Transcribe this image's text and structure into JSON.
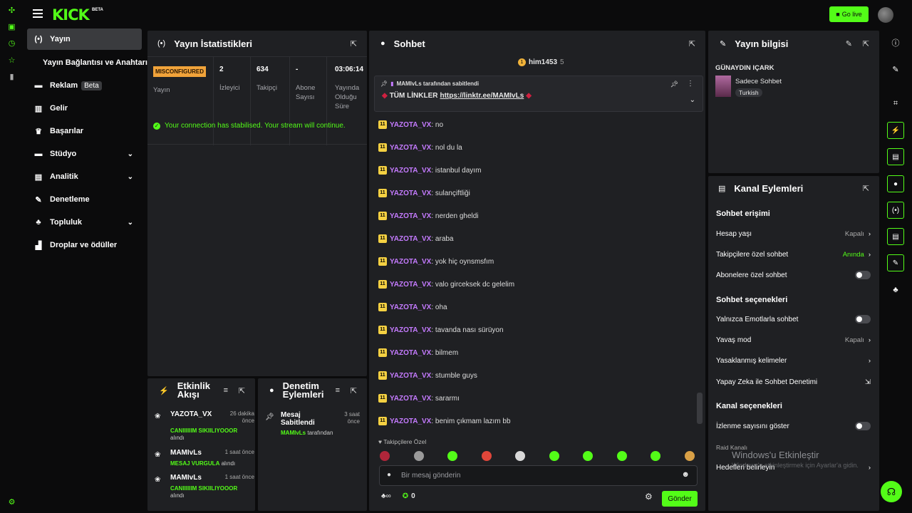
{
  "top": {
    "brand": "KICK",
    "brand_sup": "BETA",
    "golive": "Go live"
  },
  "left_rail_icons": [
    "compass-icon",
    "video-icon",
    "clock-icon",
    "star-icon",
    "shield-icon",
    "gear-icon"
  ],
  "sidebar": {
    "items": [
      {
        "label": "Yayın",
        "icon": "broadcast-icon",
        "active": true
      },
      {
        "label": "Yayın Bağlantısı ve Anahtarı"
      },
      {
        "label": "Reklam",
        "badge": "Beta",
        "icon": "ad-icon"
      },
      {
        "label": "Gelir",
        "icon": "chart-icon"
      },
      {
        "label": "Başarılar",
        "icon": "trophy-icon"
      },
      {
        "label": "Stüdyo",
        "icon": "studio-icon",
        "expand": true
      },
      {
        "label": "Analitik",
        "icon": "analytics-icon",
        "expand": true
      },
      {
        "label": "Denetleme",
        "icon": "wrench-icon"
      },
      {
        "label": "Topluluk",
        "icon": "community-icon",
        "expand": true
      },
      {
        "label": "Droplar ve ödüller",
        "icon": "drops-icon"
      }
    ]
  },
  "stats": {
    "title": "Yayın İstatistikleri",
    "status_badge": "MISCONFIGURED",
    "status_label": "Yayın",
    "viewers": "2",
    "viewers_label": "İzleyici",
    "followers": "634",
    "followers_label": "Takipçi",
    "subs": "-",
    "subs_label": "Abone Sayısı",
    "uptime": "03:06:14",
    "uptime_label": "Yayında Olduğu Süre",
    "connection": "Your connection has stabilised. Your stream will continue."
  },
  "activity": {
    "title": "Etkinlik Akışı",
    "events": [
      {
        "name": "YAZOTA_VX",
        "time": "26 dakika önce",
        "desc_hl": "CANIIIIIIM SIKIILIYOOOR",
        "desc": "alındı"
      },
      {
        "name": "MAMIvLs",
        "time": "1 saat önce",
        "desc_hl": "MESAJ VURGULA",
        "desc": "alındı"
      },
      {
        "name": "MAMIvLs",
        "time": "1 saat önce",
        "desc_hl": "CANIIIIIIM SIKIILIYOOOR",
        "desc": "alındı"
      }
    ]
  },
  "moderation": {
    "title": "Denetim Eylemleri",
    "event": {
      "name": "Mesaj Sabitlendi",
      "time": "3 saat önce",
      "by_hl": "MAMIvLs",
      "by": "tarafından"
    }
  },
  "chat": {
    "title": "Sohbet",
    "top_user": "him1453",
    "top_count": "5",
    "pinned_by": "MAMIvLs tarafından sabitlendi",
    "pinned_text": "TÜM LİNKLER",
    "pinned_link": "https://linktr.ee/MAMIvLs",
    "messages": [
      {
        "badge": "11",
        "user": "YAZOTA_VX",
        "text": "no"
      },
      {
        "badge": "11",
        "user": "YAZOTA_VX",
        "text": "nol du la"
      },
      {
        "badge": "11",
        "user": "YAZOTA_VX",
        "text": "istanbul dayım"
      },
      {
        "badge": "11",
        "user": "YAZOTA_VX",
        "text": "sulançiftliği"
      },
      {
        "badge": "11",
        "user": "YAZOTA_VX",
        "text": "nerden gheldi"
      },
      {
        "badge": "11",
        "user": "YAZOTA_VX",
        "text": "araba"
      },
      {
        "badge": "11",
        "user": "YAZOTA_VX",
        "text": "yok hiç oynsmsfım"
      },
      {
        "badge": "11",
        "user": "YAZOTA_VX",
        "text": "valo girceksek dc gelelim"
      },
      {
        "badge": "11",
        "user": "YAZOTA_VX",
        "text": "oha"
      },
      {
        "badge": "11",
        "user": "YAZOTA_VX",
        "text": "tavanda nası sürüyon"
      },
      {
        "badge": "11",
        "user": "YAZOTA_VX",
        "text": "bilmem"
      },
      {
        "badge": "11",
        "user": "YAZOTA_VX",
        "text": "stumble guys"
      },
      {
        "badge": "11",
        "user": "YAZOTA_VX",
        "text": "sararmı"
      },
      {
        "badge": "11",
        "user": "YAZOTA_VX",
        "text": "benim çıkmam lazım bb"
      }
    ],
    "followers_only": "Takipçilere Özel",
    "input_placeholder": "Bir mesaj gönderin",
    "points": "0",
    "send": "Gönder",
    "emote_colors": [
      "#b0263a",
      "#9a9a9a",
      "#53fc18",
      "#e0463a",
      "#d8d8d8",
      "#53fc18",
      "#53fc18",
      "#53fc18",
      "#53fc18",
      "#d9a046"
    ]
  },
  "stream_info": {
    "title": "Yayın bilgisi",
    "stream_title": "GÜNAYDIN IÇARK",
    "category": "Sadece Sohbet",
    "language": "Turkish"
  },
  "channel_actions": {
    "title": "Kanal Eylemleri",
    "chat_access": "Sohbet erişimi",
    "account_age": "Hesap yaşı",
    "account_age_val": "Kapalı",
    "followers_only": "Takipçilere özel sohbet",
    "followers_only_val": "Anında",
    "subs_only": "Abonelere özel sohbet",
    "chat_options": "Sohbet seçenekleri",
    "emote_only": "Yalnızca Emotlarla sohbet",
    "slow_mode": "Yavaş mod",
    "slow_mode_val": "Kapalı",
    "banned_words": "Yasaklanmış kelimeler",
    "ai_mod": "Yapay Zeka ile Sohbet Denetimi",
    "channel_options": "Kanal seçenekleri",
    "show_viewers": "İzlenme sayısını göster",
    "raid": "Raid Kanalı",
    "target": "Hedefleri belirleyin"
  },
  "watermark": {
    "line1": "Windows'u Etkinleştir",
    "line2": "Windows'u etkinleştirmek için Ayarlar'a gidin."
  }
}
